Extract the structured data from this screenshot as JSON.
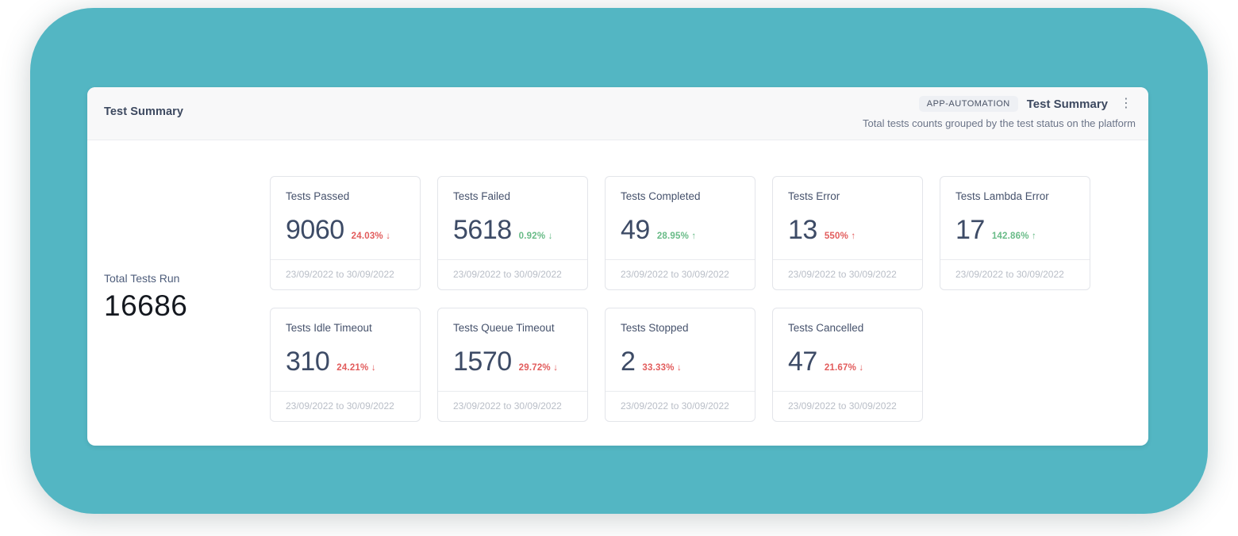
{
  "stage": {
    "background_color": "#53b6c3"
  },
  "header": {
    "title": "Test Summary",
    "badge_label": "APP-AUTOMATION",
    "widget_title": "Test Summary",
    "subtitle": "Total tests counts grouped by the test status on the platform",
    "kebab_glyph": "⋮"
  },
  "totals": {
    "label": "Total Tests Run",
    "value": "16686"
  },
  "date_range": "23/09/2022 to 30/09/2022",
  "colors": {
    "positive": "#68bb87",
    "negative": "#e25c5c"
  },
  "cards": [
    {
      "title": "Tests Passed",
      "value": "9060",
      "delta": "24.03%",
      "arrow": "↓",
      "trend": "negative"
    },
    {
      "title": "Tests Failed",
      "value": "5618",
      "delta": "0.92%",
      "arrow": "↓",
      "trend": "positive"
    },
    {
      "title": "Tests Completed",
      "value": "49",
      "delta": "28.95%",
      "arrow": "↑",
      "trend": "positive"
    },
    {
      "title": "Tests Error",
      "value": "13",
      "delta": "550%",
      "arrow": "↑",
      "trend": "negative"
    },
    {
      "title": "Tests Lambda Error",
      "value": "17",
      "delta": "142.86%",
      "arrow": "↑",
      "trend": "positive"
    },
    {
      "title": "Tests Idle Timeout",
      "value": "310",
      "delta": "24.21%",
      "arrow": "↓",
      "trend": "negative"
    },
    {
      "title": "Tests Queue Timeout",
      "value": "1570",
      "delta": "29.72%",
      "arrow": "↓",
      "trend": "negative"
    },
    {
      "title": "Tests Stopped",
      "value": "2",
      "delta": "33.33%",
      "arrow": "↓",
      "trend": "negative"
    },
    {
      "title": "Tests Cancelled",
      "value": "47",
      "delta": "21.67%",
      "arrow": "↓",
      "trend": "negative"
    }
  ]
}
